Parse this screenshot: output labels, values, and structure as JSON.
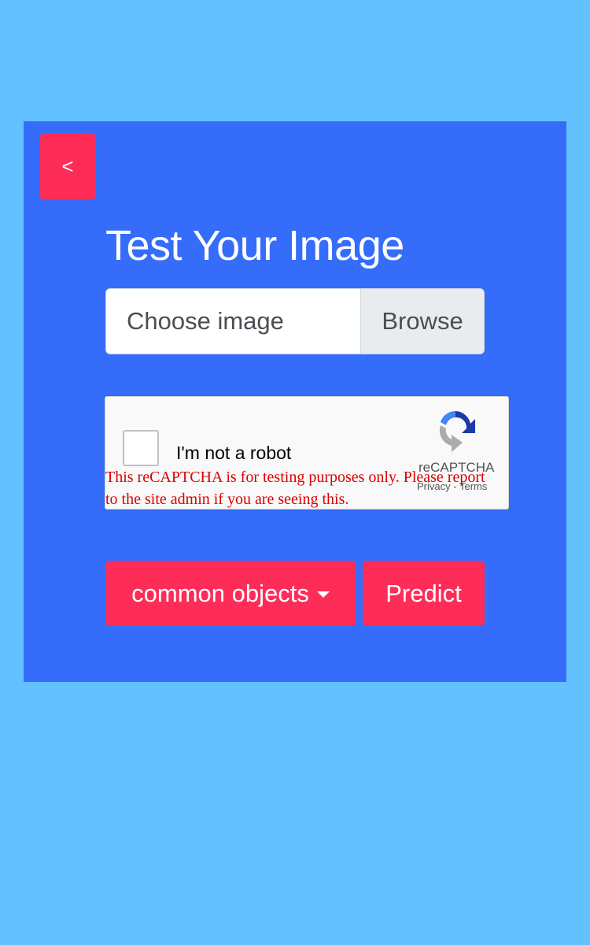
{
  "header": {
    "back_label": "<"
  },
  "main": {
    "title": "Test Your Image",
    "file_input": {
      "placeholder": "Choose image",
      "browse_label": "Browse"
    },
    "recaptcha": {
      "label": "I'm not a robot",
      "brand": "reCAPTCHA",
      "privacy_label": "Privacy",
      "separator": "-",
      "terms_label": "Terms",
      "warning": "This reCAPTCHA is for testing purposes only. Please report to the site admin if you are seeing this."
    },
    "category_select": {
      "selected": "common objects"
    },
    "predict_label": "Predict"
  },
  "colors": {
    "page_background": "#62c1fe",
    "card_background": "#356dfa",
    "accent": "#fd2d58",
    "warning_text": "#dd0000"
  },
  "icons": {
    "category_caret": "caret-down-icon",
    "recaptcha_logo": "recaptcha-logo-icon"
  }
}
